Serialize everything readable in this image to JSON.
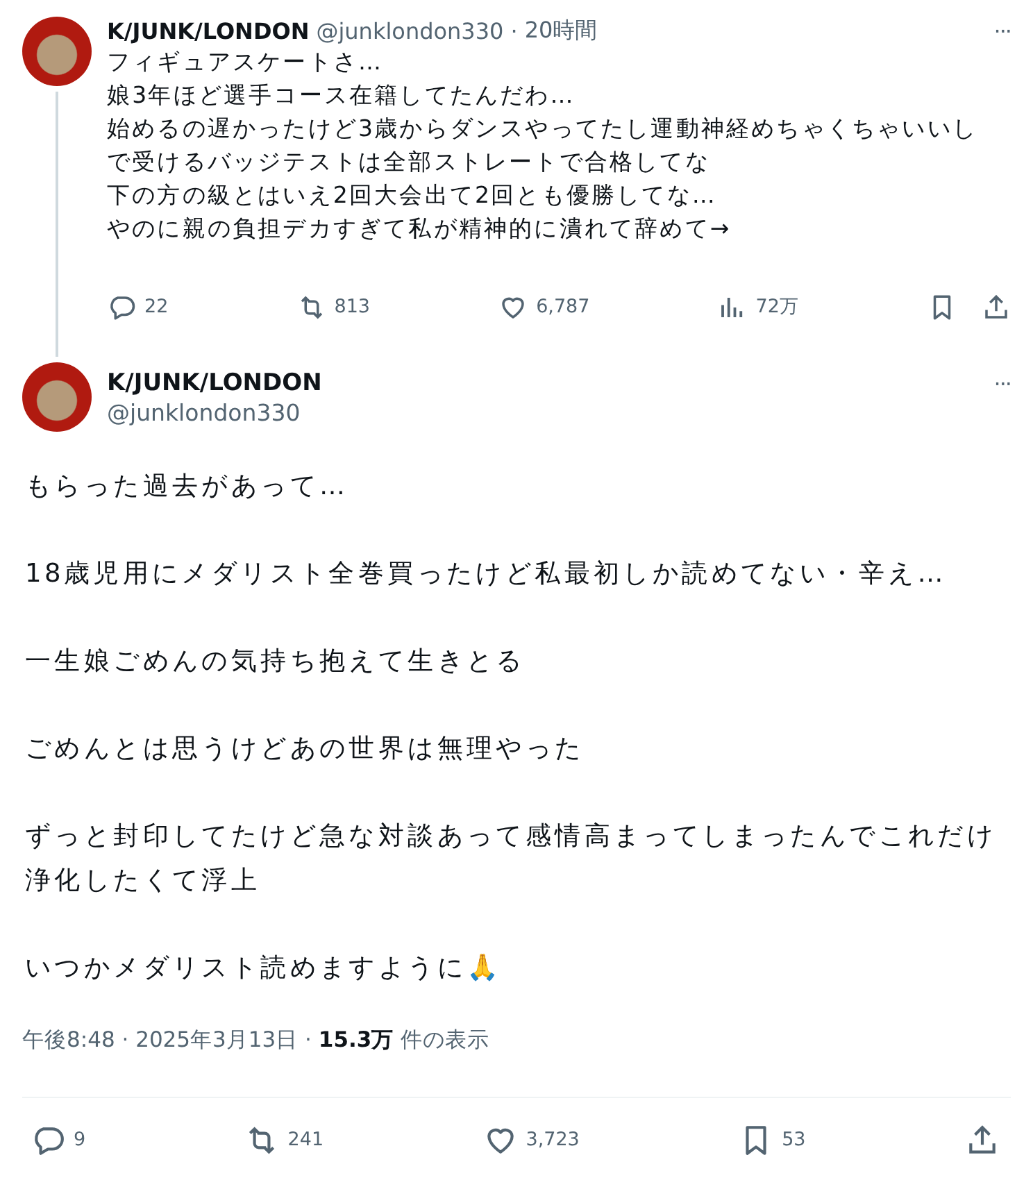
{
  "thread_tweet": {
    "name": "K/JUNK/LONDON",
    "handle": "@junklondon330",
    "separator": "·",
    "time": "20時間",
    "more": "···",
    "lines": [
      "フィギュアスケートさ…",
      "娘3年ほど選手コース在籍してたんだわ…",
      "始めるの遅かったけど3歳からダンスやってたし運動神経めちゃくちゃいいし",
      "で受けるバッジテストは全部ストレートで合格してな",
      "下の方の級とはいえ2回大会出て2回とも優勝してな…",
      "やのに親の負担デカすぎて私が精神的に潰れて辞めて→"
    ],
    "actions": [
      {
        "kind": "reply",
        "count": "22"
      },
      {
        "kind": "retweet",
        "count": "813"
      },
      {
        "kind": "like",
        "count": "6,787"
      },
      {
        "kind": "views",
        "count": "72万"
      },
      {
        "kind": "bookmark"
      },
      {
        "kind": "share"
      }
    ]
  },
  "main_tweet": {
    "name": "K/JUNK/LONDON",
    "handle": "@junklondon330",
    "more": "···",
    "paragraphs": [
      "もらった過去があって…",
      "18歳児用にメダリスト全巻買ったけど私最初しか読めてない・辛え…",
      "一生娘ごめんの気持ち抱えて生きとる",
      "ごめんとは思うけどあの世界は無理やった",
      "ずっと封印してたけど急な対談あって感情高まってしまったんでこれだけ浄化したくて浮上",
      "いつかメダリスト読めますように🙏"
    ],
    "meta": "午後8:48 · 2025年3月13日 · **15.3万** 件の表示",
    "actions": [
      {
        "kind": "reply",
        "count": "9"
      },
      {
        "kind": "retweet",
        "count": "241"
      },
      {
        "kind": "like",
        "count": "3,723"
      },
      {
        "kind": "bookmark",
        "count": "53"
      },
      {
        "kind": "share"
      }
    ]
  }
}
